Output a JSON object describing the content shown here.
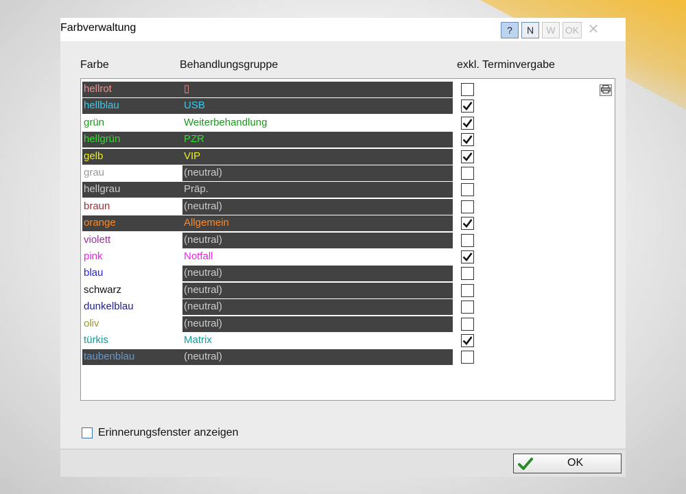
{
  "window": {
    "title": "Farbverwaltung",
    "buttons": {
      "help": "?",
      "n": "N",
      "w": "W",
      "ok": "OK",
      "close": "✕"
    }
  },
  "headers": {
    "farbe": "Farbe",
    "gruppe": "Behandlungsgruppe",
    "exkl": "exkl. Terminvergabe"
  },
  "rows": [
    {
      "farbe": "hellrot",
      "gruppe": "▯",
      "color": "#f09090",
      "farbe_dark": true,
      "gruppe_dark": true,
      "checked": false
    },
    {
      "farbe": "hellblau",
      "gruppe": "USB",
      "color": "#33ccee",
      "farbe_dark": true,
      "gruppe_dark": true,
      "checked": true
    },
    {
      "farbe": "grün",
      "gruppe": "Weiterbehandlung",
      "color": "#1a9a1a",
      "farbe_dark": false,
      "gruppe_dark": false,
      "checked": true
    },
    {
      "farbe": "hellgrün",
      "gruppe": "PZR",
      "color": "#33dd33",
      "farbe_dark": true,
      "gruppe_dark": true,
      "checked": true
    },
    {
      "farbe": "gelb",
      "gruppe": "VIP",
      "color": "#eeee22",
      "farbe_dark": true,
      "gruppe_dark": true,
      "checked": true
    },
    {
      "farbe": "grau",
      "gruppe": "(neutral)",
      "color": "#999999",
      "farbe_dark": false,
      "gruppe_dark": true,
      "gruppe_color": "#cccccc",
      "checked": false
    },
    {
      "farbe": "hellgrau",
      "gruppe": "Präp.",
      "color": "#cccccc",
      "farbe_dark": true,
      "gruppe_dark": true,
      "checked": false
    },
    {
      "farbe": "braun",
      "gruppe": "(neutral)",
      "color": "#993333",
      "farbe_dark": false,
      "gruppe_dark": true,
      "gruppe_color": "#cccccc",
      "checked": false
    },
    {
      "farbe": "orange",
      "gruppe": "Allgemein",
      "color": "#ff8822",
      "farbe_dark": true,
      "gruppe_dark": true,
      "checked": true
    },
    {
      "farbe": "violett",
      "gruppe": "(neutral)",
      "color": "#993399",
      "farbe_dark": false,
      "gruppe_dark": true,
      "gruppe_color": "#cccccc",
      "checked": false
    },
    {
      "farbe": "pink",
      "gruppe": "Notfall",
      "color": "#ee22ee",
      "farbe_dark": false,
      "gruppe_dark": false,
      "checked": true
    },
    {
      "farbe": "blau",
      "gruppe": "(neutral)",
      "color": "#2222ee",
      "farbe_dark": false,
      "gruppe_dark": true,
      "gruppe_color": "#cccccc",
      "checked": false
    },
    {
      "farbe": "schwarz",
      "gruppe": "(neutral)",
      "color": "#111111",
      "farbe_dark": false,
      "gruppe_dark": true,
      "gruppe_color": "#cccccc",
      "checked": false
    },
    {
      "farbe": "dunkelblau",
      "gruppe": "(neutral)",
      "color": "#222288",
      "farbe_dark": false,
      "gruppe_dark": true,
      "gruppe_color": "#cccccc",
      "checked": false
    },
    {
      "farbe": "oliv",
      "gruppe": "(neutral)",
      "color": "#999922",
      "farbe_dark": false,
      "gruppe_dark": true,
      "gruppe_color": "#cccccc",
      "checked": false
    },
    {
      "farbe": "türkis",
      "gruppe": "Matrix",
      "color": "#119999",
      "farbe_dark": false,
      "gruppe_dark": false,
      "checked": true
    },
    {
      "farbe": "taubenblau",
      "gruppe": "(neutral)",
      "color": "#6699cc",
      "farbe_dark": true,
      "gruppe_dark": true,
      "gruppe_color": "#cccccc",
      "checked": false
    }
  ],
  "print_icon": "printer-icon",
  "reminder": {
    "label": "Erinnerungsfenster anzeigen",
    "checked": false
  },
  "ok_button": {
    "label": "OK",
    "icon": "checkmark-icon",
    "icon_color": "#2a8a2a"
  }
}
